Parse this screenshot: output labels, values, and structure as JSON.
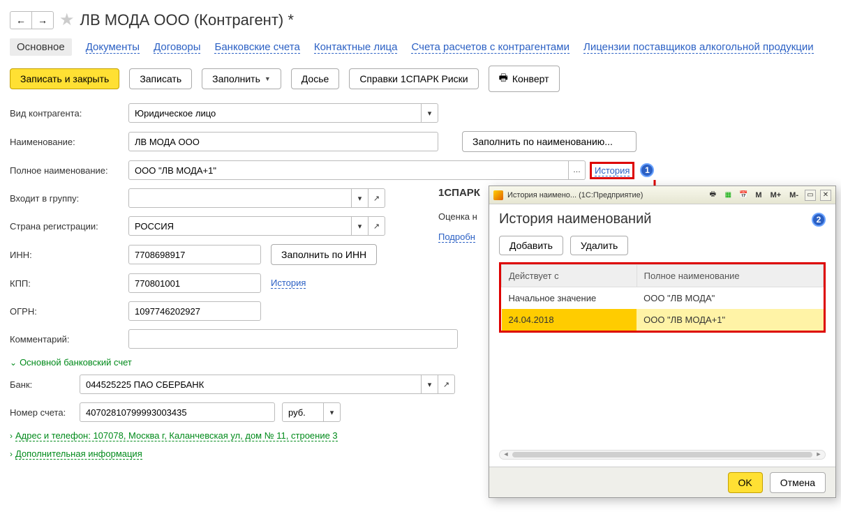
{
  "header": {
    "title": "ЛВ МОДА ООО (Контрагент) *"
  },
  "tabs": {
    "main": "Основное",
    "documents": "Документы",
    "contracts": "Договоры",
    "bank_accounts": "Банковские счета",
    "contacts": "Контактные лица",
    "settlements": "Счета расчетов с контрагентами",
    "licenses": "Лицензии поставщиков алкогольной продукции"
  },
  "toolbar": {
    "save_close": "Записать и закрыть",
    "save": "Записать",
    "fill": "Заполнить",
    "dossier": "Досье",
    "spark": "Справки 1СПАРК Риски",
    "envelope": "Конверт"
  },
  "form": {
    "counterparty_type_label": "Вид контрагента:",
    "counterparty_type_value": "Юридическое лицо",
    "name_label": "Наименование:",
    "name_value": "ЛВ МОДА ООО",
    "fill_by_name": "Заполнить по наименованию...",
    "full_name_label": "Полное наименование:",
    "full_name_value": "ООО \"ЛВ МОДА+1\"",
    "history_link": "История",
    "group_label": "Входит в группу:",
    "group_value": "",
    "country_label": "Страна регистрации:",
    "country_value": "РОССИЯ",
    "inn_label": "ИНН:",
    "inn_value": "7708698917",
    "fill_by_inn": "Заполнить по ИНН",
    "kpp_label": "КПП:",
    "kpp_value": "770801001",
    "kpp_history": "История",
    "ogrn_label": "ОГРН:",
    "ogrn_value": "1097746202927",
    "comment_label": "Комментарий:",
    "comment_value": ""
  },
  "bank_section": {
    "heading": "Основной банковский счет",
    "bank_label": "Банк:",
    "bank_value": "044525225 ПАО СБЕРБАНК",
    "account_label": "Номер счета:",
    "account_value": "40702810799993003435",
    "currency": "руб."
  },
  "address_section": {
    "heading": "Адрес и телефон: 107078, Москва г, Каланчевская ул, дом № 11, строение 3"
  },
  "extra_section": {
    "heading": "Дополнительная информация"
  },
  "spark": {
    "title": "1СПАРК",
    "rating_label": "Оценка н",
    "more": "Подробн"
  },
  "callouts": {
    "one": "1",
    "two": "2"
  },
  "modal": {
    "titlebar": "История наимено... (1С:Предприятие)",
    "heading": "История наименований",
    "add": "Добавить",
    "delete": "Удалить",
    "col_date": "Действует с",
    "col_name": "Полное наименование",
    "rows": [
      {
        "date": "Начальное значение",
        "name": "ООО \"ЛВ МОДА\""
      },
      {
        "date": "24.04.2018",
        "name": "ООО \"ЛВ МОДА+1\""
      }
    ],
    "m": "M",
    "mplus": "M+",
    "mminus": "M-",
    "ok": "OK",
    "cancel": "Отмена"
  }
}
